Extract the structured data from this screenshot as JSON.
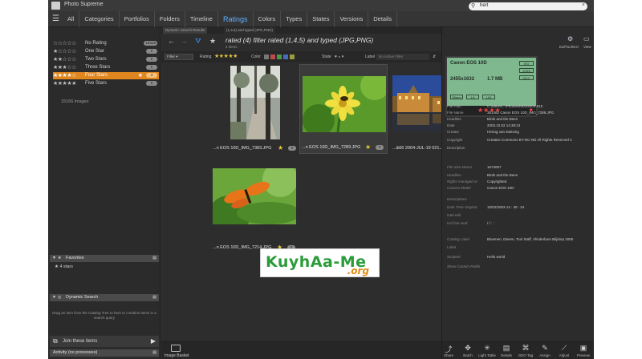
{
  "app": {
    "title": "Photo Supreme",
    "subtitle": ""
  },
  "search": {
    "value": "hert"
  },
  "nav": {
    "tabs": [
      "All",
      "Categories",
      "Portfolios",
      "Folders",
      "Timeline",
      "Ratings",
      "Colors",
      "Types",
      "States",
      "Versions",
      "Details"
    ],
    "active": "Ratings"
  },
  "ratings": [
    {
      "stars": "☆☆☆☆☆",
      "label": "No Rating",
      "count": "15028"
    },
    {
      "stars": "★☆☆☆☆",
      "label": "One Star",
      "count": "0"
    },
    {
      "stars": "★★☆☆☆",
      "label": "Two Stars",
      "count": "0"
    },
    {
      "stars": "★★★☆☆",
      "label": "Three Stars",
      "count": "0"
    },
    {
      "stars": "★★★★☆",
      "label": "Four Stars",
      "count": "4"
    },
    {
      "stars": "★★★★★",
      "label": "Five Stars",
      "count": "0"
    }
  ],
  "images_count": "15166 images",
  "favorites": {
    "title": "Favorites",
    "item": "4 stars"
  },
  "dynamic_search": {
    "title": "Dynamic Search",
    "help": "Drag an item from the Catalog Tree to here to combine items in a search query",
    "join_label": "Join these items"
  },
  "activity": {
    "label": "Activity (no processes)"
  },
  "center": {
    "tab1": "Dynamic Search Results",
    "tab2": "(1,4,5) and typed (JPG,PNG)",
    "query_title": "rated  (4) filter rated  (1,4,5) and typed (JPG,PNG)",
    "query_sub": "4 items",
    "filter_sort": "Filter",
    "rating_label": "Rating",
    "rating_stars": "★★★★★",
    "color_label": "Color",
    "state_label": "State",
    "label_label": "Label",
    "label_placeholder": "No Active Filter",
    "basket_label": "Image Basket"
  },
  "thumbs": [
    {
      "caption": "...n EOS 10D_IMG_7383.JPG",
      "badge": "0"
    },
    {
      "caption": "...n EOS 10D_IMG_7289.JPG",
      "badge": "0"
    },
    {
      "caption": "...&66 2004-JUL-19 021.JPG",
      "badge": "0"
    },
    {
      "caption": "...n EOS 10D_IMG_7214.JPG",
      "badge": "0"
    }
  ],
  "watermark": {
    "main": "KuyhAa-Me",
    "sub": ".org"
  },
  "right": {
    "tools": [
      {
        "icon": "⚙",
        "label": "ExifToolGUI"
      },
      {
        "icon": "▭",
        "label": "View"
      }
    ],
    "lcd": {
      "camera": "Canon EOS 10D",
      "resolution": "2455x1632",
      "size": "1.7 MB",
      "chips": [
        "ISO",
        "1/320",
        "f/8.0",
        "55mm",
        "1/4",
        "100"
      ]
    },
    "meta": [
      {
        "k": "File Path",
        "v": "C:\\Users\\...\\Photos\\2003\\2003-010"
      },
      {
        "k": "File Name",
        "v": "351462 Canon EOS 10D_IMG_7289.JPG"
      },
      {
        "k": "Headline",
        "v": "Birds and the Bees"
      },
      {
        "k": "Date",
        "v": "2003.10.02 14:39:24"
      },
      {
        "k": "Creator",
        "v": "Hertog van Zwitsing"
      },
      {
        "k": "Copyright",
        "v": "Creative Commons BY-NC-ND  All Rights Reserved 2"
      },
      {
        "k": "Description",
        "v": ""
      },
      {
        "k": "File Size Macro",
        "v": "1674057"
      },
      {
        "k": "Headline",
        "v": "Birds and the Bees"
      },
      {
        "k": "Rights managed or",
        "v": "Copyrighted"
      },
      {
        "k": "Camera Model",
        "v": "Canon EOS 10D"
      },
      {
        "k": "Descriptions",
        "v": ""
      },
      {
        "k": "Date Time Original",
        "v": "10/02/2003    14 : 39 : 24"
      },
      {
        "k": "Intel edit",
        "v": ""
      },
      {
        "k": "Ivcf last mod",
        "v": "/  /          :  :"
      },
      {
        "k": "Catalog Label",
        "v": "Bloemen, Dieren, Tool Staff, Vlinderbom Blijdorp 2005"
      },
      {
        "k": "Label",
        "v": ""
      },
      {
        "k": "Scripted",
        "v": "Hello world"
      },
      {
        "k": "Show Custom Fields",
        "v": ""
      }
    ],
    "bottom_tools": [
      {
        "icon": "i",
        "label": "Info"
      },
      {
        "icon": "⤴",
        "label": "Share"
      },
      {
        "icon": "✥",
        "label": "Batch"
      },
      {
        "icon": "✳",
        "label": "Light Table"
      },
      {
        "icon": "▤",
        "label": "Details"
      },
      {
        "icon": "⌘",
        "label": "GEO Tag"
      },
      {
        "icon": "✎",
        "label": "Assign"
      },
      {
        "icon": "⟋",
        "label": "Adjust"
      },
      {
        "icon": "▣",
        "label": "Preview"
      }
    ]
  },
  "colors": {
    "accent": "#5fb2ff",
    "selected": "#e0861e",
    "star": "#e8c83a",
    "swatches": [
      "#777777",
      "#c04a4a",
      "#4a9a4a",
      "#4a6ac0",
      "#9a9a40"
    ]
  }
}
